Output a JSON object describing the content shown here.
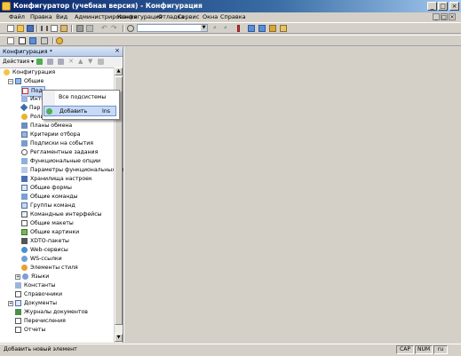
{
  "window": {
    "title": "Конфигуратор (учебная версия) - Конфигурация",
    "minimize": "_",
    "maximize": "□",
    "close": "×"
  },
  "menu": {
    "items": [
      "Файл",
      "Правка",
      "Вид",
      "Администрирование",
      "Конфигурация",
      "Отладка",
      "Сервис",
      "Окна",
      "Справка"
    ],
    "mdi_min": "_",
    "mdi_restore": "□",
    "mdi_close": "×"
  },
  "panel": {
    "title": "Конфигурация *",
    "close": "×",
    "actions_label": "Действия ▾"
  },
  "tree": {
    "root": "Конфигурация",
    "common": "Общие",
    "children": [
      "Под",
      "Инте",
      "Пар",
      "Роли",
      "Планы обмена",
      "Критерии отбора",
      "Подписки на события",
      "Регламентные задания",
      "Функциональные опции",
      "Параметры функциональных опций",
      "Хранилища настроек",
      "Общие формы",
      "Общие команды",
      "Группы команд",
      "Командные интерфейсы",
      "Общие макеты",
      "Общие картинки",
      "XDTO-пакеты",
      "Web-сервисы",
      "WS-ссылки",
      "Элементы стиля"
    ],
    "after": [
      "Языки",
      "Константы",
      "Справочники",
      "Документы",
      "Журналы документов",
      "Перечисления",
      "Отчеты"
    ]
  },
  "context_menu": {
    "items": [
      {
        "label": "Все подсистемы",
        "key": ""
      },
      {
        "label": "Добавить",
        "key": "Ins"
      }
    ]
  },
  "status": {
    "text": "Добавить новый элемент",
    "cap": "CAP",
    "num": "NUM",
    "lang": "ru"
  },
  "colors": {
    "title_start": "#0a246a",
    "title_end": "#a6caf0",
    "selection": "#c6d9f5"
  }
}
